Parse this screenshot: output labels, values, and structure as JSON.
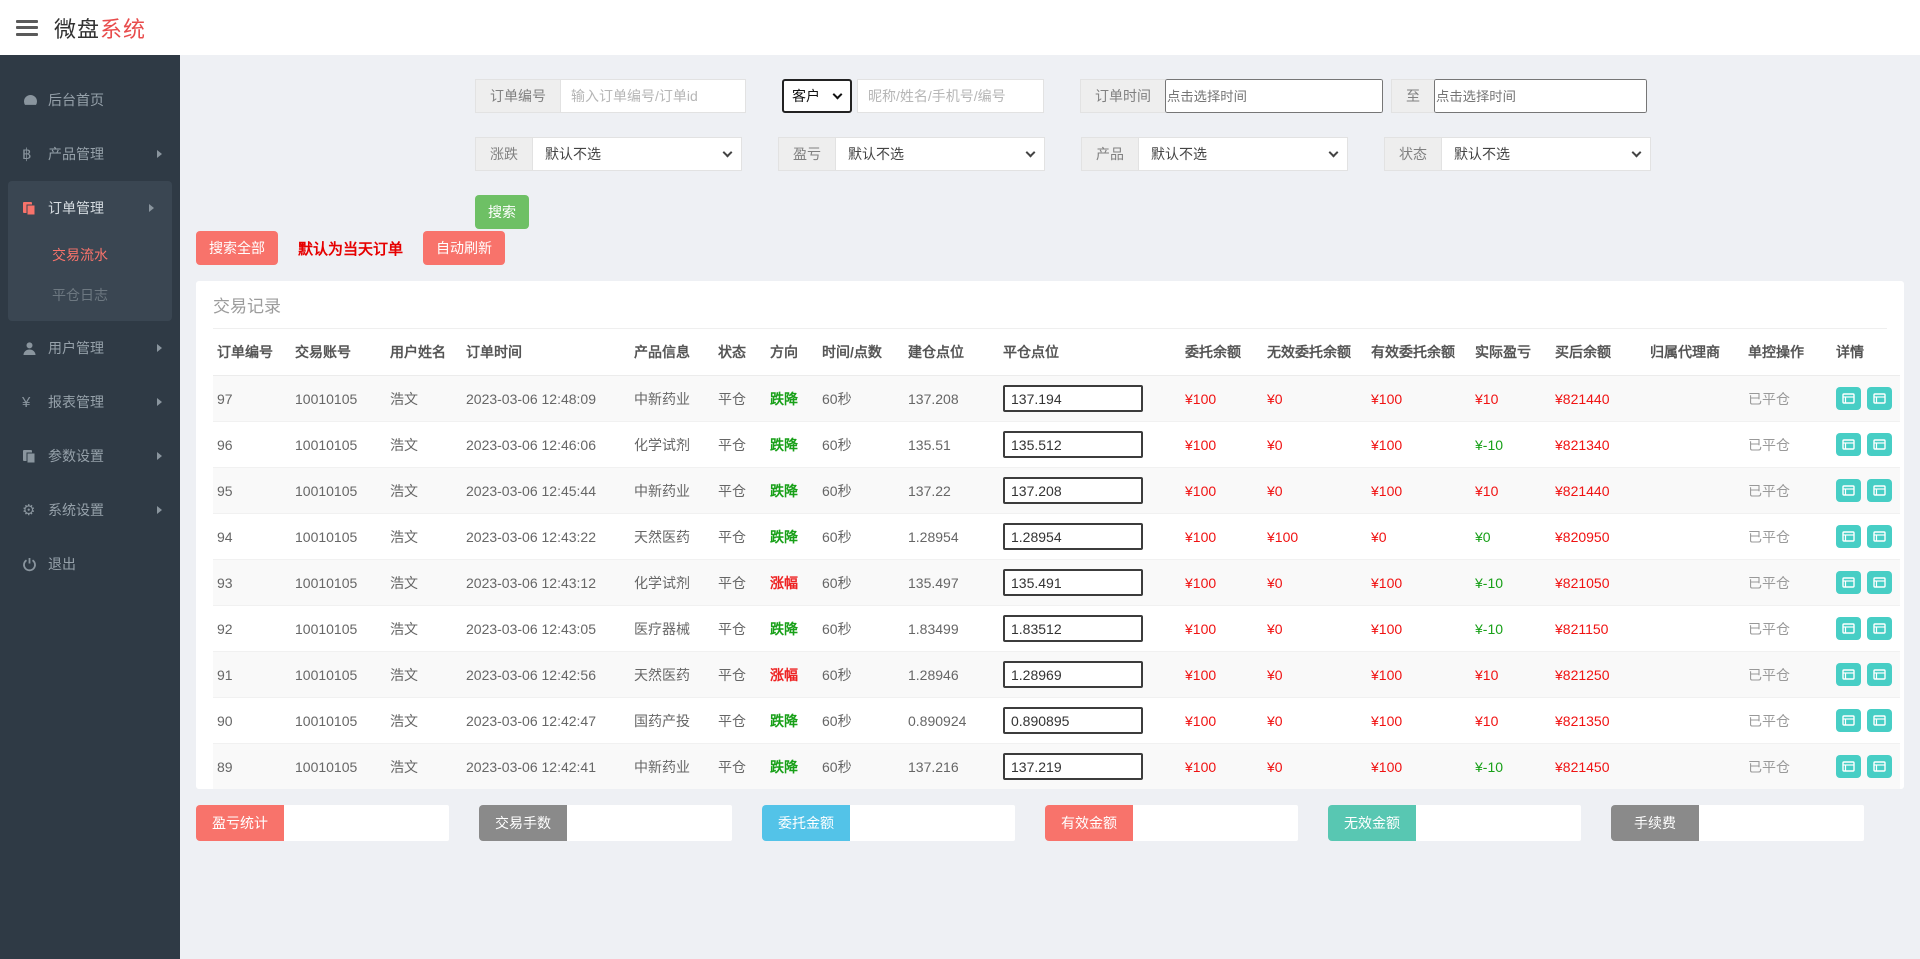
{
  "header": {
    "brand_black": "微盘",
    "brand_red": "系统"
  },
  "sidebar": {
    "items": [
      {
        "label": "后台首页",
        "icon": "dashboard-icon"
      },
      {
        "label": "产品管理",
        "icon": "bitcoin-icon"
      },
      {
        "label": "订单管理",
        "icon": "orders-icon"
      },
      {
        "label": "交易流水",
        "active": true
      },
      {
        "label": "平仓日志"
      },
      {
        "label": "用户管理",
        "icon": "user-icon"
      },
      {
        "label": "报表管理",
        "icon": "yen-icon"
      },
      {
        "label": "参数设置",
        "icon": "params-icon"
      },
      {
        "label": "系统设置",
        "icon": "gear-icon"
      },
      {
        "label": "退出",
        "icon": "power-icon"
      }
    ]
  },
  "search": {
    "order_no_label": "订单编号",
    "order_no_placeholder": "输入订单编号/订单id",
    "customer_selected": "客户",
    "customer_placeholder": "昵称/姓名/手机号/编号",
    "time_label": "订单时间",
    "time_placeholder": "点击选择时间",
    "to_label": "至",
    "filters": [
      {
        "label": "涨跌",
        "value": "默认不选"
      },
      {
        "label": "盈亏",
        "value": "默认不选"
      },
      {
        "label": "产品",
        "value": "默认不选"
      },
      {
        "label": "状态",
        "value": "默认不选"
      }
    ],
    "search_button": "搜索",
    "search_all_button": "搜索全部",
    "today_note": "默认为当天订单",
    "auto_refresh_button": "自动刷新"
  },
  "table": {
    "title": "交易记录",
    "columns": [
      "订单编号",
      "交易账号",
      "用户姓名",
      "订单时间",
      "产品信息",
      "状态",
      "方向",
      "时间/点数",
      "建仓点位",
      "平仓点位",
      "委托余额",
      "无效委托余额",
      "有效委托余额",
      "实际盈亏",
      "买后余额",
      "归属代理商",
      "单控操作",
      "详情"
    ],
    "rows": [
      {
        "id": "97",
        "account": "10010105",
        "name": "浩文",
        "time": "2023-03-06 12:48:09",
        "product": "中新药业",
        "status": "平仓",
        "direction": "跌降",
        "dir_class": "g",
        "period": "60秒",
        "open": "137.208",
        "close": "137.194",
        "entrust": "¥100",
        "invalid": "¥0",
        "valid": "¥100",
        "profit": "¥10",
        "profit_class": "t-red",
        "balance": "¥821440",
        "agent": "",
        "control": "已平仓"
      },
      {
        "id": "96",
        "account": "10010105",
        "name": "浩文",
        "time": "2023-03-06 12:46:06",
        "product": "化学试剂",
        "status": "平仓",
        "direction": "跌降",
        "dir_class": "g",
        "period": "60秒",
        "open": "135.51",
        "close": "135.512",
        "entrust": "¥100",
        "invalid": "¥0",
        "valid": "¥100",
        "profit": "¥-10",
        "profit_class": "t-green",
        "balance": "¥821340",
        "agent": "",
        "control": "已平仓"
      },
      {
        "id": "95",
        "account": "10010105",
        "name": "浩文",
        "time": "2023-03-06 12:45:44",
        "product": "中新药业",
        "status": "平仓",
        "direction": "跌降",
        "dir_class": "g",
        "period": "60秒",
        "open": "137.22",
        "close": "137.208",
        "entrust": "¥100",
        "invalid": "¥0",
        "valid": "¥100",
        "profit": "¥10",
        "profit_class": "t-red",
        "balance": "¥821440",
        "agent": "",
        "control": "已平仓"
      },
      {
        "id": "94",
        "account": "10010105",
        "name": "浩文",
        "time": "2023-03-06 12:43:22",
        "product": "天然医药",
        "status": "平仓",
        "direction": "跌降",
        "dir_class": "g",
        "period": "60秒",
        "open": "1.28954",
        "close": "1.28954",
        "entrust": "¥100",
        "invalid": "¥100",
        "valid": "¥0",
        "profit": "¥0",
        "profit_class": "t-green",
        "balance": "¥820950",
        "agent": "",
        "control": "已平仓"
      },
      {
        "id": "93",
        "account": "10010105",
        "name": "浩文",
        "time": "2023-03-06 12:43:12",
        "product": "化学试剂",
        "status": "平仓",
        "direction": "涨幅",
        "dir_class": "r",
        "period": "60秒",
        "open": "135.497",
        "close": "135.491",
        "entrust": "¥100",
        "invalid": "¥0",
        "valid": "¥100",
        "profit": "¥-10",
        "profit_class": "t-green",
        "balance": "¥821050",
        "agent": "",
        "control": "已平仓"
      },
      {
        "id": "92",
        "account": "10010105",
        "name": "浩文",
        "time": "2023-03-06 12:43:05",
        "product": "医疗器械",
        "status": "平仓",
        "direction": "跌降",
        "dir_class": "g",
        "period": "60秒",
        "open": "1.83499",
        "close": "1.83512",
        "entrust": "¥100",
        "invalid": "¥0",
        "valid": "¥100",
        "profit": "¥-10",
        "profit_class": "t-green",
        "balance": "¥821150",
        "agent": "",
        "control": "已平仓"
      },
      {
        "id": "91",
        "account": "10010105",
        "name": "浩文",
        "time": "2023-03-06 12:42:56",
        "product": "天然医药",
        "status": "平仓",
        "direction": "涨幅",
        "dir_class": "r",
        "period": "60秒",
        "open": "1.28946",
        "close": "1.28969",
        "entrust": "¥100",
        "invalid": "¥0",
        "valid": "¥100",
        "profit": "¥10",
        "profit_class": "t-red",
        "balance": "¥821250",
        "agent": "",
        "control": "已平仓"
      },
      {
        "id": "90",
        "account": "10010105",
        "name": "浩文",
        "time": "2023-03-06 12:42:47",
        "product": "国药产投",
        "status": "平仓",
        "direction": "跌降",
        "dir_class": "g",
        "period": "60秒",
        "open": "0.890924",
        "close": "0.890895",
        "entrust": "¥100",
        "invalid": "¥0",
        "valid": "¥100",
        "profit": "¥10",
        "profit_class": "t-red",
        "balance": "¥821350",
        "agent": "",
        "control": "已平仓"
      },
      {
        "id": "89",
        "account": "10010105",
        "name": "浩文",
        "time": "2023-03-06 12:42:41",
        "product": "中新药业",
        "status": "平仓",
        "direction": "跌降",
        "dir_class": "g",
        "period": "60秒",
        "open": "137.216",
        "close": "137.219",
        "entrust": "¥100",
        "invalid": "¥0",
        "valid": "¥100",
        "profit": "¥-10",
        "profit_class": "t-green",
        "balance": "¥821450",
        "agent": "",
        "control": "已平仓"
      }
    ]
  },
  "stats": [
    {
      "label": "盈亏统计",
      "cls": "salmon",
      "value": ""
    },
    {
      "label": "交易手数",
      "cls": "gray",
      "value": ""
    },
    {
      "label": "委托金额",
      "cls": "blue",
      "value": ""
    },
    {
      "label": "有效金额",
      "cls": "salmon",
      "value": ""
    },
    {
      "label": "无效金额",
      "cls": "teal",
      "value": ""
    },
    {
      "label": "手续费",
      "cls": "gray",
      "value": ""
    }
  ],
  "colors": {
    "accent_red": "#f8736b",
    "accent_green": "#6ec065",
    "teal_button": "#47cec5",
    "money_red": "#f01212",
    "money_green": "#18a018",
    "sidebar_bg": "#2f3a45"
  }
}
